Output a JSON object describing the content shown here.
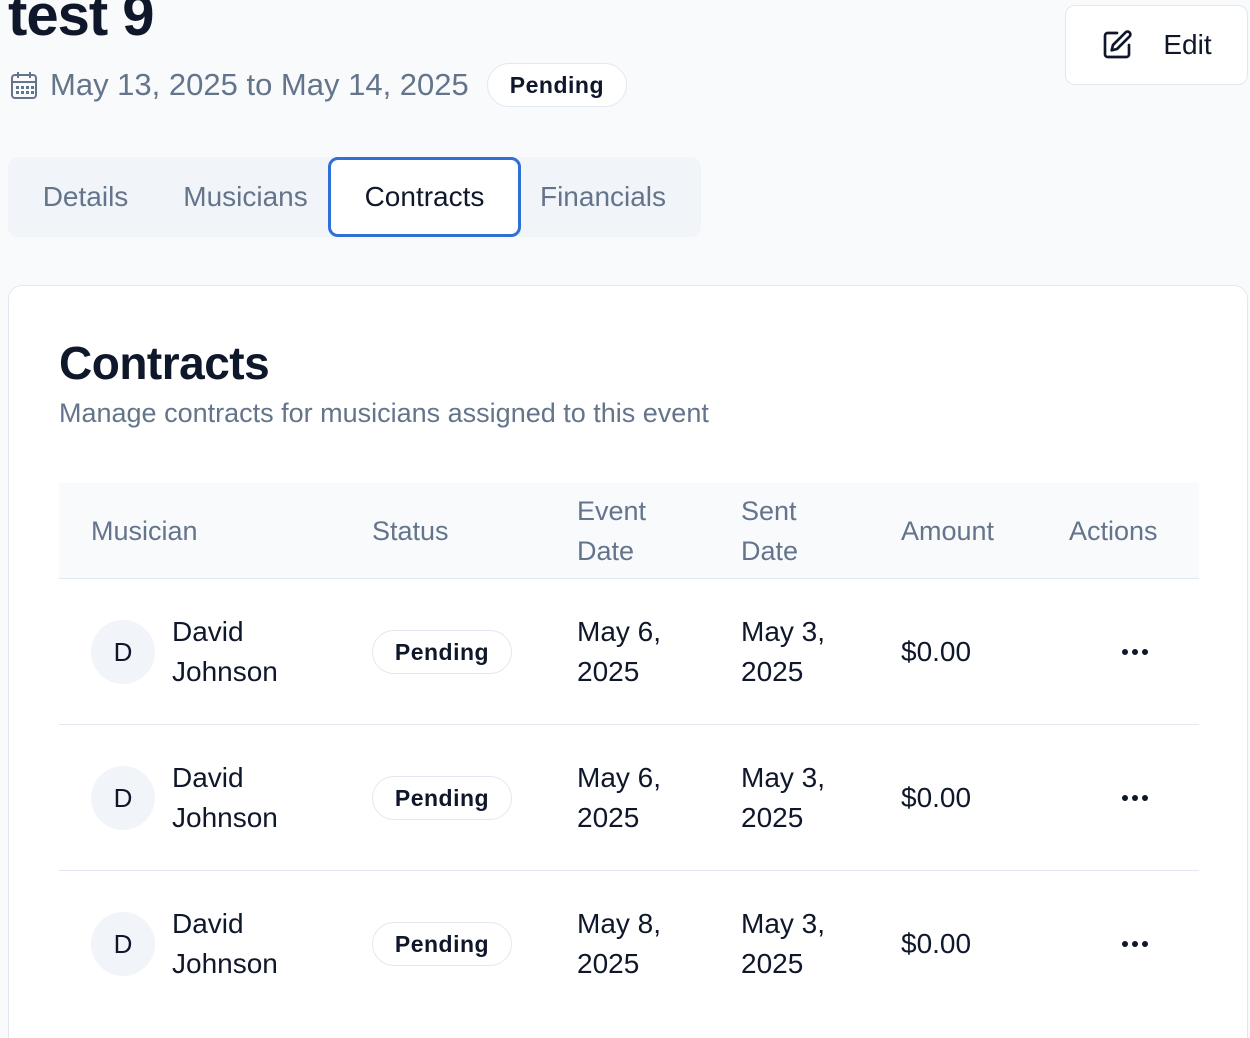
{
  "header": {
    "title": "test 9",
    "date_range": "May 13, 2025 to May 14, 2025",
    "status": "Pending",
    "edit_label": "Edit"
  },
  "tabs": [
    {
      "label": "Details",
      "active": false
    },
    {
      "label": "Musicians",
      "active": false
    },
    {
      "label": "Contracts",
      "active": true
    },
    {
      "label": "Financials",
      "active": false
    }
  ],
  "contracts": {
    "title": "Contracts",
    "subtitle": "Manage contracts for musicians assigned to this event",
    "columns": {
      "musician": "Musician",
      "status": "Status",
      "event_date": "Event Date",
      "sent_date": "Sent Date",
      "amount": "Amount",
      "actions": "Actions"
    },
    "rows": [
      {
        "initial": "D",
        "first": "David",
        "last": "Johnson",
        "status": "Pending",
        "event_date_1": "May 6,",
        "event_date_2": "2025",
        "sent_date_1": "May 3,",
        "sent_date_2": "2025",
        "amount": "$0.00"
      },
      {
        "initial": "D",
        "first": "David",
        "last": "Johnson",
        "status": "Pending",
        "event_date_1": "May 6,",
        "event_date_2": "2025",
        "sent_date_1": "May 3,",
        "sent_date_2": "2025",
        "amount": "$0.00"
      },
      {
        "initial": "D",
        "first": "David",
        "last": "Johnson",
        "status": "Pending",
        "event_date_1": "May 8,",
        "event_date_2": "2025",
        "sent_date_1": "May 3,",
        "sent_date_2": "2025",
        "amount": "$0.00"
      }
    ]
  },
  "icons": {
    "calendar": "calendar-icon",
    "edit": "pencil-square-icon",
    "actions": "more-horizontal-icon"
  },
  "colors": {
    "accent": "#2f6fd6",
    "muted_text": "#64748b",
    "border": "#e2e8f0"
  }
}
